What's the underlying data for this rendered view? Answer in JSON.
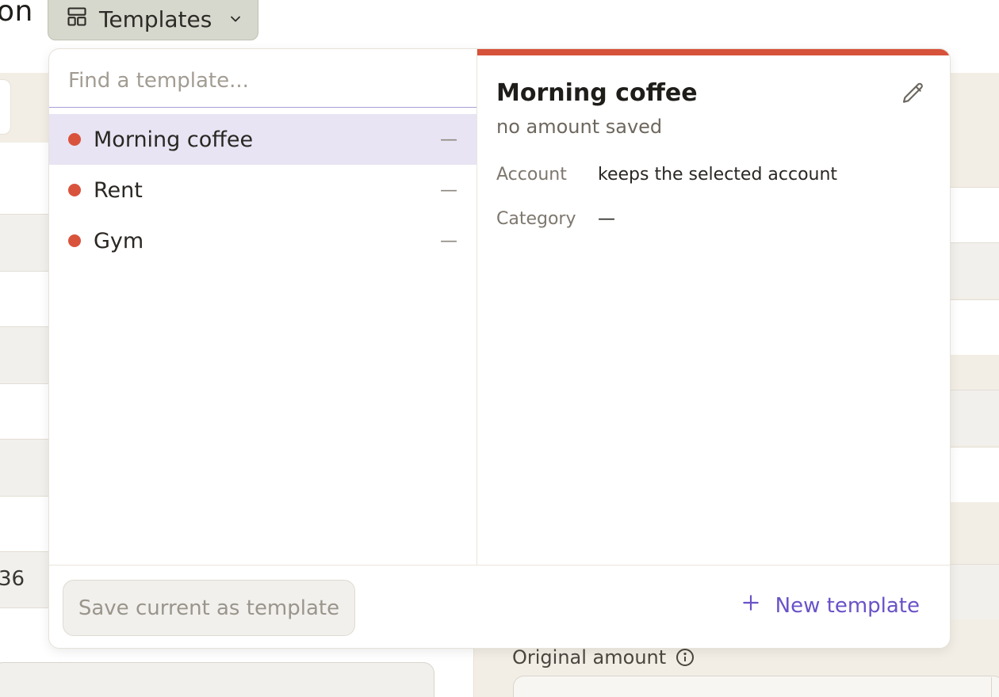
{
  "header": {
    "title_fragment": "on",
    "templates_button_label": "Templates"
  },
  "templates": {
    "search_placeholder": "Find a template...",
    "items": [
      {
        "name": "Morning coffee",
        "amount": "—",
        "color": "#d9533c",
        "selected": true
      },
      {
        "name": "Rent",
        "amount": "—",
        "color": "#d9533c",
        "selected": false
      },
      {
        "name": "Gym",
        "amount": "—",
        "color": "#d9533c",
        "selected": false
      }
    ]
  },
  "detail": {
    "title": "Morning coffee",
    "subtitle": "no amount saved",
    "rows": [
      {
        "key": "Account",
        "value": "keeps the selected account"
      },
      {
        "key": "Category",
        "value": "—"
      }
    ],
    "accent_color": "#d6523b"
  },
  "footer": {
    "save_label": "Save current as template",
    "new_label": "New template"
  },
  "background": {
    "left_value_fragment": "36",
    "original_amount_label": "Original amount"
  }
}
